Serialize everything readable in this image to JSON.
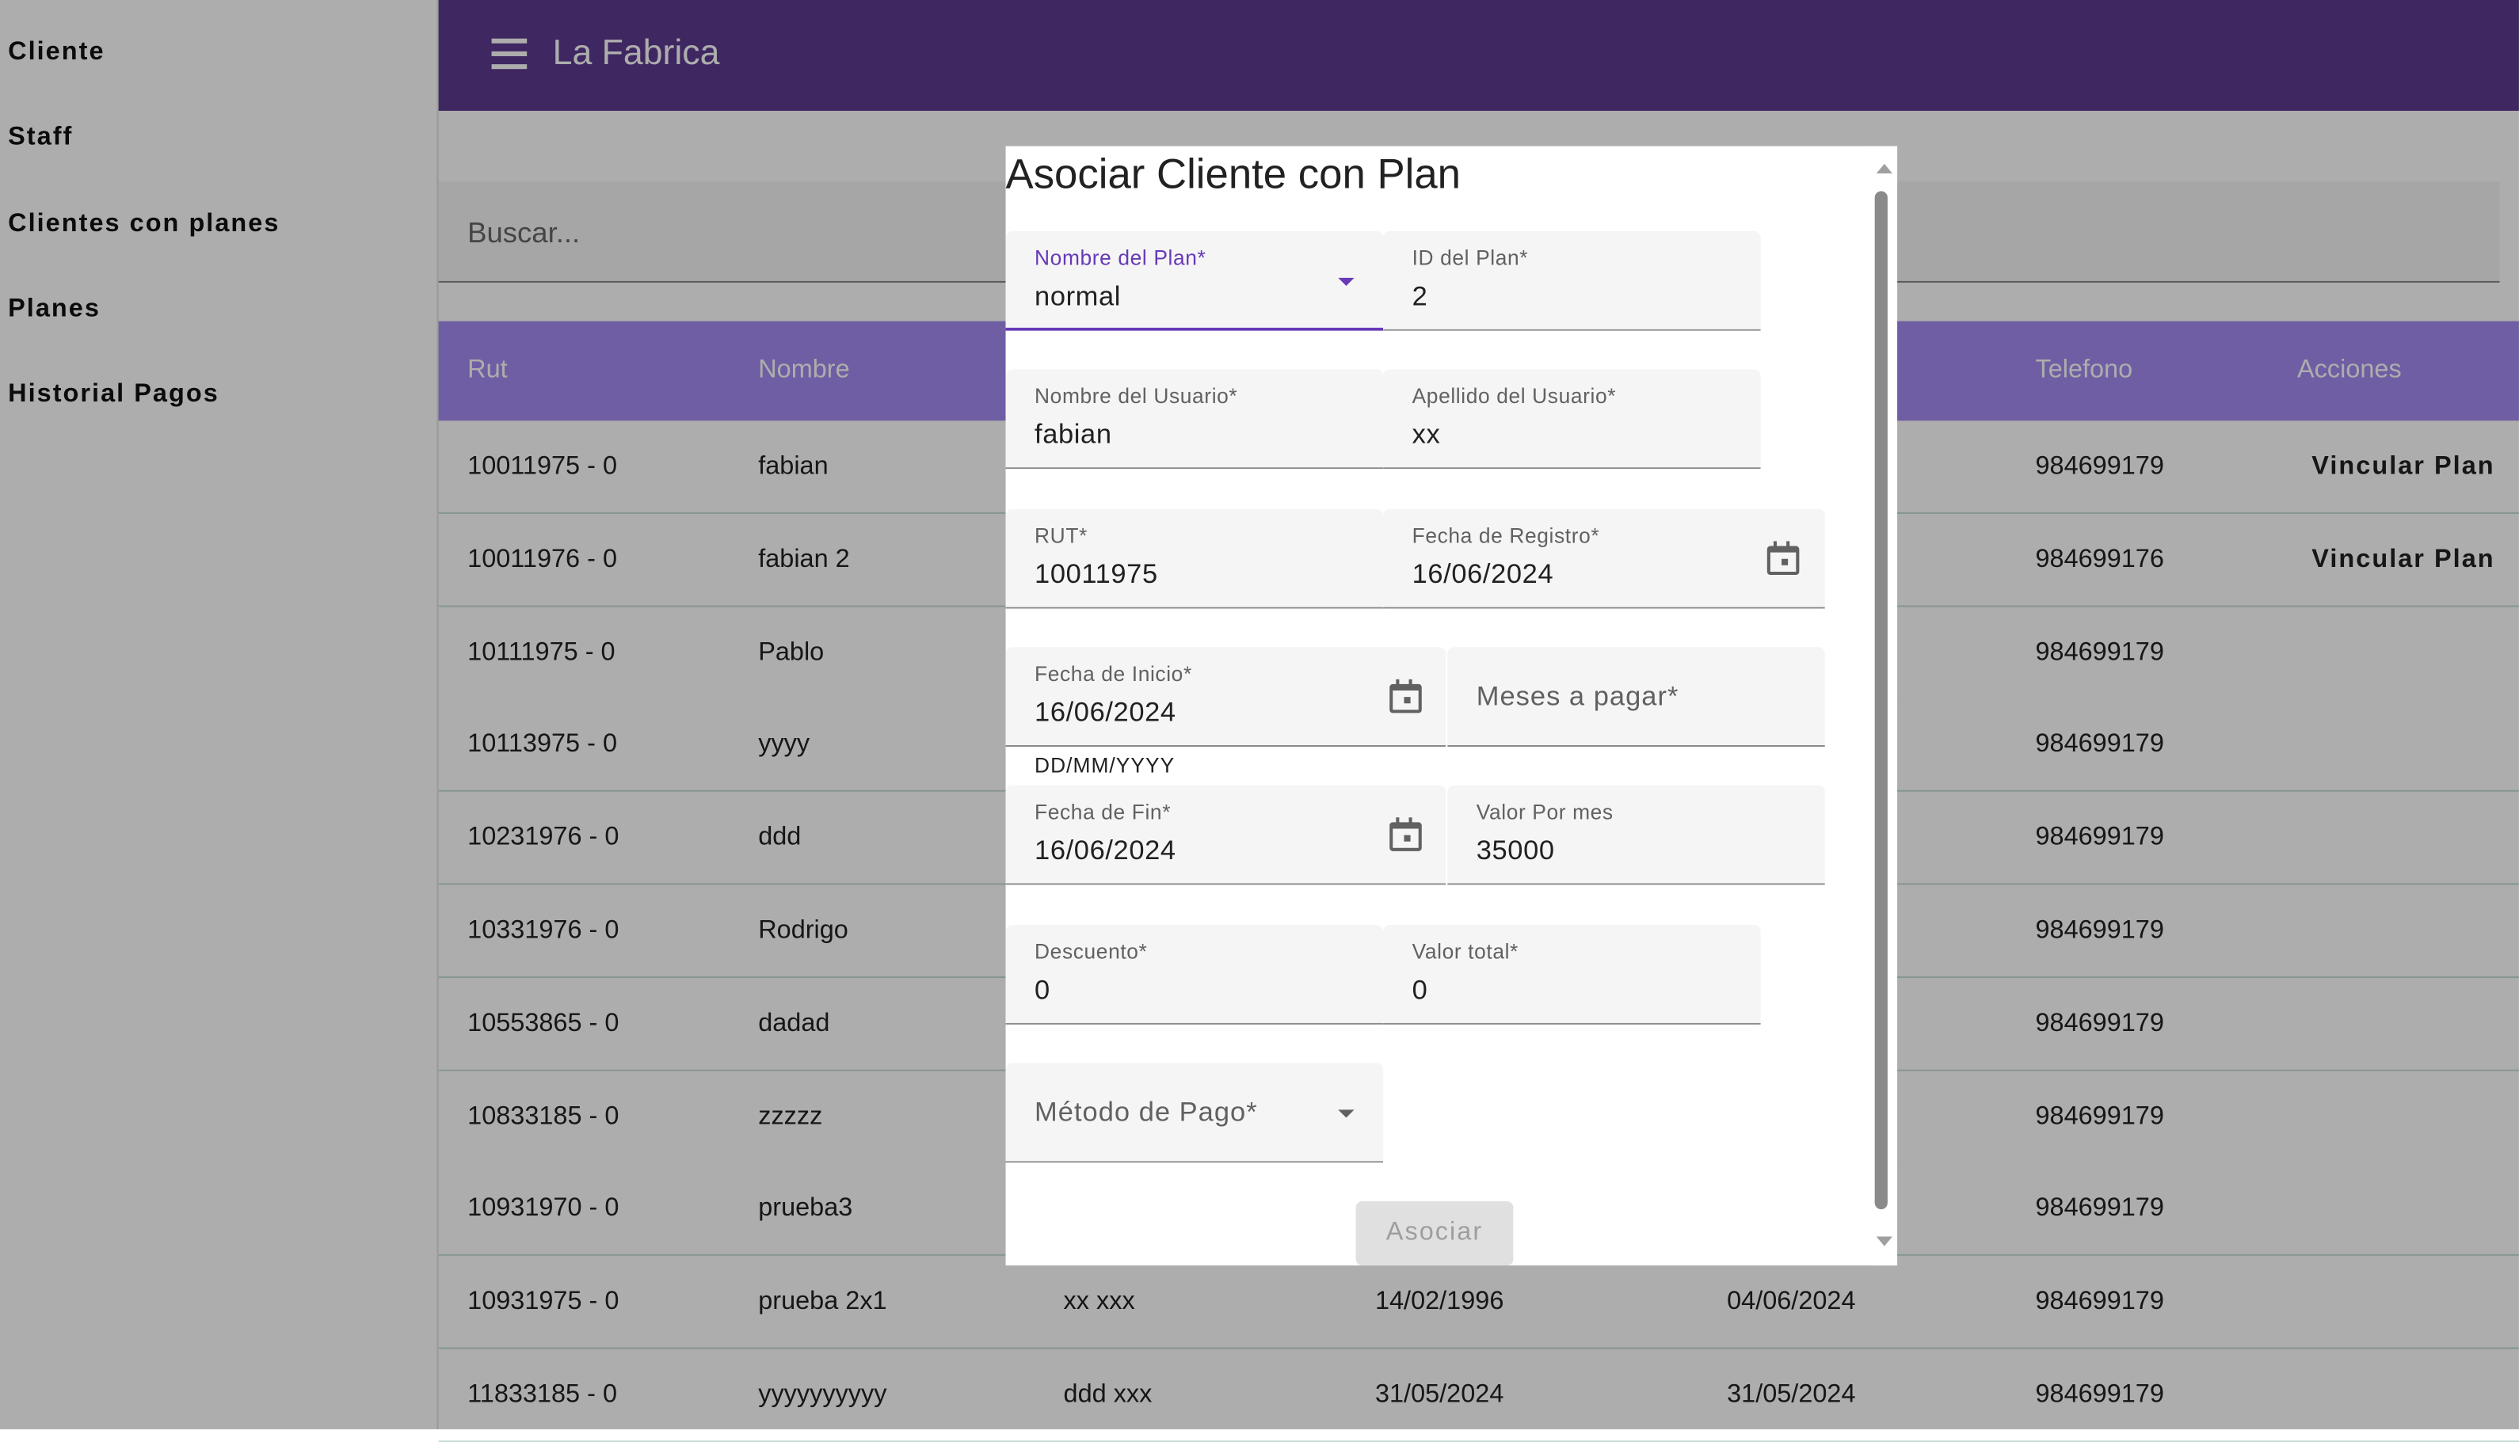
{
  "sidebar": {
    "items": [
      {
        "label": "Cliente"
      },
      {
        "label": "Staff"
      },
      {
        "label": "Clientes con planes"
      },
      {
        "label": "Planes"
      },
      {
        "label": "Historial Pagos"
      }
    ]
  },
  "header": {
    "title": "La Fabrica",
    "menu_icon": "menu-icon",
    "color": "#5e3a8f"
  },
  "search": {
    "placeholder": "Buscar..."
  },
  "table": {
    "header_color": "#a48bf0",
    "columns": [
      "Rut",
      "Nombre",
      "Telefono",
      "Acciones"
    ],
    "rows": [
      {
        "rut": "10011975 - 0",
        "nombre": "fabian",
        "col3": "",
        "col4": "",
        "col5": "",
        "telefono": "984699179",
        "accion": "Vincular Plan"
      },
      {
        "rut": "10011976 - 0",
        "nombre": "fabian 2",
        "col3": "",
        "col4": "",
        "col5": "",
        "telefono": "984699176",
        "accion": "Vincular Plan"
      },
      {
        "rut": "10111975 - 0",
        "nombre": "Pablo",
        "col3": "",
        "col4": "",
        "col5": "",
        "telefono": "984699179",
        "accion": ""
      },
      {
        "rut": "10113975 - 0",
        "nombre": "yyyy",
        "col3": "",
        "col4": "",
        "col5": "",
        "telefono": "984699179",
        "accion": ""
      },
      {
        "rut": "10231976 - 0",
        "nombre": "ddd",
        "col3": "",
        "col4": "",
        "col5": "",
        "telefono": "984699179",
        "accion": ""
      },
      {
        "rut": "10331976 - 0",
        "nombre": "Rodrigo",
        "col3": "",
        "col4": "",
        "col5": "",
        "telefono": "984699179",
        "accion": ""
      },
      {
        "rut": "10553865 - 0",
        "nombre": "dadad",
        "col3": "",
        "col4": "",
        "col5": "",
        "telefono": "984699179",
        "accion": ""
      },
      {
        "rut": "10833185 - 0",
        "nombre": "zzzzz",
        "col3": "",
        "col4": "",
        "col5": "",
        "telefono": "984699179",
        "accion": ""
      },
      {
        "rut": "10931970 - 0",
        "nombre": "prueba3",
        "col3": "",
        "col4": "",
        "col5": "",
        "telefono": "984699179",
        "accion": ""
      },
      {
        "rut": "10931975 - 0",
        "nombre": "prueba 2x1",
        "col3": "xx xxx",
        "col4": "14/02/1996",
        "col5": "04/06/2024",
        "telefono": "984699179",
        "accion": ""
      },
      {
        "rut": "11833185 - 0",
        "nombre": "yyyyyyyyyy",
        "col3": "ddd xxx",
        "col4": "31/05/2024",
        "col5": "31/05/2024",
        "telefono": "984699179",
        "accion": ""
      }
    ]
  },
  "dialog": {
    "title": "Asociar Cliente con Plan",
    "fields": {
      "nombre_plan": {
        "label": "Nombre del Plan*",
        "value": "normal"
      },
      "id_plan": {
        "label": "ID del Plan*",
        "value": "2"
      },
      "nombre_usuario": {
        "label": "Nombre del Usuario*",
        "value": "fabian"
      },
      "apellido_usuario": {
        "label": "Apellido del Usuario*",
        "value": "xx"
      },
      "rut": {
        "label": "RUT*",
        "value": "10011975"
      },
      "fecha_registro": {
        "label": "Fecha de Registro*",
        "value": "16/06/2024"
      },
      "fecha_inicio": {
        "label": "Fecha de Inicio*",
        "value": "16/06/2024",
        "hint": "DD/MM/YYYY"
      },
      "meses_pagar": {
        "placeholder": "Meses a pagar*"
      },
      "fecha_fin": {
        "label": "Fecha de Fin*",
        "value": "16/06/2024"
      },
      "valor_mes": {
        "label": "Valor Por mes",
        "value": "35000"
      },
      "descuento": {
        "label": "Descuento*",
        "value": "0"
      },
      "valor_total": {
        "label": "Valor total*",
        "value": "0"
      },
      "metodo_pago": {
        "placeholder": "Método de Pago*"
      }
    },
    "submit_label": "Asociar",
    "accent_color": "#673ab7"
  }
}
